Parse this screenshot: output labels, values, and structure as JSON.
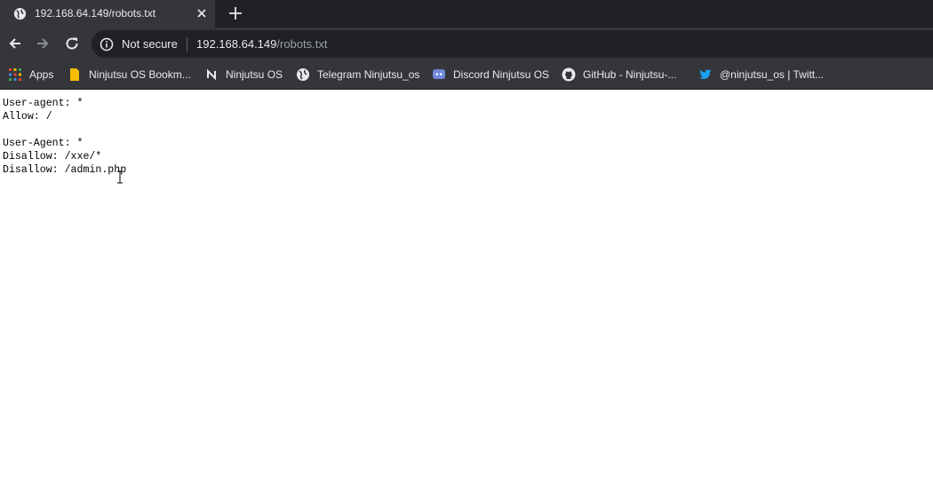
{
  "tab": {
    "title": "192.168.64.149/robots.txt"
  },
  "toolbar": {
    "security_label": "Not secure",
    "url_host": "192.168.64.149",
    "url_path": "/robots.txt"
  },
  "bookmarks": {
    "items": [
      {
        "label": "Apps",
        "icon": "apps-grid-icon"
      },
      {
        "label": "Ninjutsu OS Bookm...",
        "icon": "folder-icon"
      },
      {
        "label": "Ninjutsu OS",
        "icon": "ninjutsu-n-icon"
      },
      {
        "label": "Telegram Ninjutsu_os",
        "icon": "globe-icon"
      },
      {
        "label": "Discord Ninjutsu OS",
        "icon": "discord-icon"
      },
      {
        "label": "GitHub - Ninjutsu-...",
        "icon": "github-icon"
      },
      {
        "label": "@ninjutsu_os | Twitt...",
        "icon": "twitter-icon"
      }
    ]
  },
  "page": {
    "text": "User-agent: *\nAllow: /\n\nUser-Agent: *\nDisallow: /xxe/*\nDisallow: /admin.php"
  },
  "colors": {
    "chrome_dark": "#202124",
    "chrome_toolbar": "#35363a",
    "chrome_text": "#e8eaed",
    "url_path_gray": "#9aa0a6"
  }
}
